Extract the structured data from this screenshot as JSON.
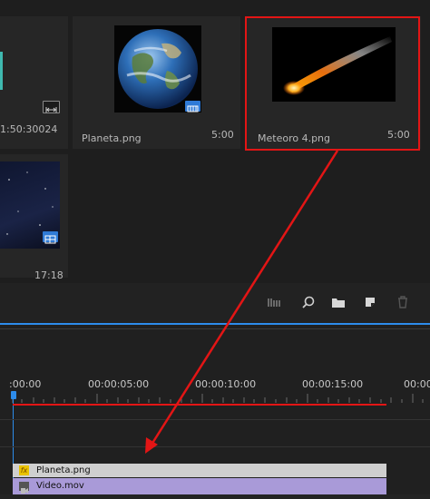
{
  "project": {
    "items": [
      {
        "name": "",
        "duration": "1:50:30024",
        "badge_icon": "clip-sequence-icon"
      },
      {
        "name": "Planeta.png",
        "duration": "5:00",
        "badge_icon": "image-badge-icon"
      },
      {
        "name": "Meteoro 4.png",
        "duration": "5:00",
        "selected": true
      },
      {
        "name": "",
        "duration": "17:18",
        "badge_icon": "image-badge-icon"
      }
    ]
  },
  "toolbar": {
    "icons": [
      "list-view-icon",
      "search-icon",
      "folder-icon",
      "new-item-icon",
      "trash-icon"
    ]
  },
  "timeline": {
    "ruler": [
      ":00:00",
      "00:00:05:00",
      "00:00:10:00",
      "00:00:15:00",
      "00:00"
    ],
    "clips": [
      {
        "name": "Planeta.png",
        "fx": "fx",
        "color": "#cfcfcf"
      },
      {
        "name": "Video.mov",
        "color": "#a99ad8"
      }
    ]
  },
  "colors": {
    "annotation": "#e31515",
    "accent_blue": "#2d8ceb",
    "badge_blue": "#2f7ad6"
  }
}
